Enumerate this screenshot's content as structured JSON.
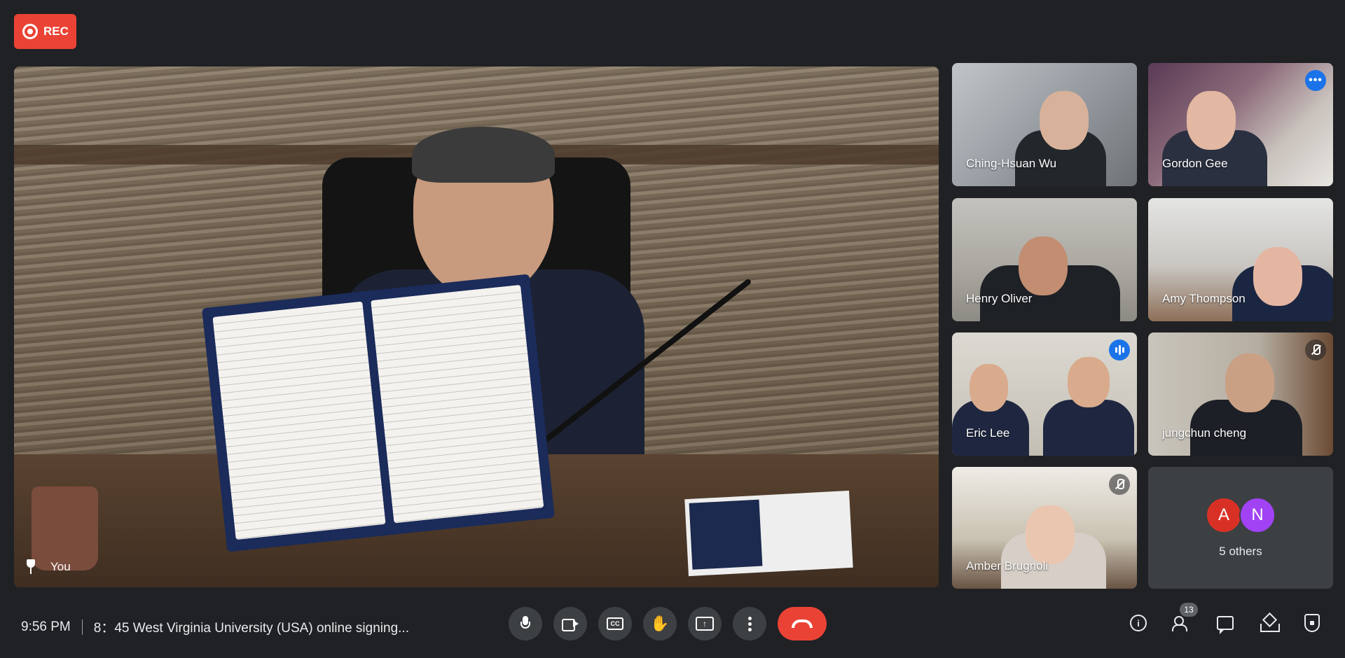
{
  "recording": {
    "label": "REC"
  },
  "main_video": {
    "participant_label": "You"
  },
  "participants": [
    {
      "name": "Ching-Hsuan Wu"
    },
    {
      "name": "Gordon Gee",
      "more_options": "•••"
    },
    {
      "name": "Henry Oliver"
    },
    {
      "name": "Amy Thompson"
    },
    {
      "name": "Eric Lee"
    },
    {
      "name": "jungchun cheng"
    },
    {
      "name": "Amber Brugnoli"
    }
  ],
  "others": {
    "avatars": [
      {
        "letter": "A",
        "color": "#d93025"
      },
      {
        "letter": "N",
        "color": "#a142f4"
      }
    ],
    "label": "5 others"
  },
  "meeting": {
    "time": "9:56 PM",
    "title": "8：45 West Virginia University (USA) online signing..."
  },
  "controls": {
    "cc_label": "CC"
  },
  "right_controls": {
    "info_label": "i",
    "participant_count": "13"
  },
  "colors": {
    "background": "#202124",
    "tile": "#3c4043",
    "accent": "#1a73e8",
    "danger": "#ea4335"
  },
  "icons": [
    "record-icon",
    "pin-icon",
    "microphone-icon",
    "camera-icon",
    "captions-icon",
    "raise-hand-icon",
    "present-icon",
    "more-options-icon",
    "end-call-icon",
    "info-icon",
    "people-icon",
    "chat-icon",
    "activities-icon",
    "host-controls-icon"
  ]
}
